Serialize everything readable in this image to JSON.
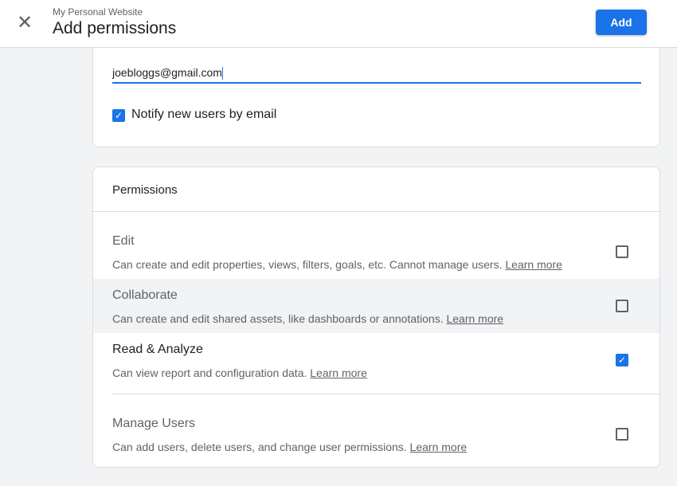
{
  "header": {
    "subtitle": "My Personal Website",
    "title": "Add permissions",
    "add_label": "Add"
  },
  "invite": {
    "email_value": "joebloggs@gmail.com",
    "notify_label": "Notify new users by email",
    "notify_checked": true
  },
  "permissions": {
    "heading": "Permissions",
    "learn_more": "Learn more",
    "items": [
      {
        "title": "Edit",
        "description": "Can create and edit properties, views, filters, goals, etc. Cannot manage users.",
        "checked": false
      },
      {
        "title": "Collaborate",
        "description": "Can create and edit shared assets, like dashboards or annotations.",
        "checked": false,
        "hovered": true
      },
      {
        "title": "Read & Analyze",
        "description": "Can view report and configuration data.",
        "checked": true
      },
      {
        "title": "Manage Users",
        "description": "Can add users, delete users, and change user permissions.",
        "checked": false
      }
    ]
  },
  "colors": {
    "accent": "#1a73e8",
    "background": "#f1f3f4"
  }
}
